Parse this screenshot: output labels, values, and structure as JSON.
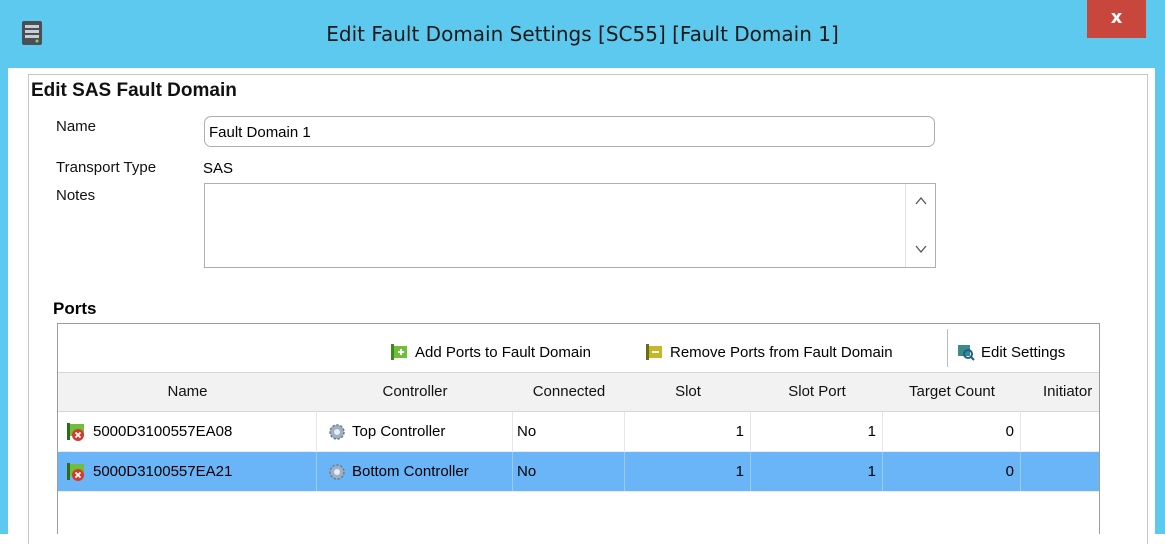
{
  "window": {
    "title": "Edit Fault Domain Settings [SC55] [Fault Domain 1]",
    "close_label": "x",
    "accent_color": "#5ec9ee",
    "close_color": "#c9463d",
    "app_icon": "storage-center-icon"
  },
  "form": {
    "section_title": "Edit SAS Fault Domain",
    "name_label": "Name",
    "name_value": "Fault Domain 1",
    "transport_label": "Transport Type",
    "transport_value": "SAS",
    "notes_label": "Notes",
    "notes_value": ""
  },
  "ports": {
    "title": "Ports",
    "toolbar": {
      "add_label": "Add Ports to Fault Domain",
      "remove_label": "Remove Ports from Fault Domain",
      "edit_label": "Edit Settings"
    },
    "columns": [
      "Name",
      "Controller",
      "Connected",
      "Slot",
      "Slot Port",
      "Target Count",
      "Initiator"
    ],
    "rows": [
      {
        "name": "5000D3100557EA08",
        "controller": "Top Controller",
        "connected": "No",
        "slot": "1",
        "slot_port": "1",
        "target_count": "0",
        "initiator": "",
        "selected": false
      },
      {
        "name": "5000D3100557EA21",
        "controller": "Bottom Controller",
        "connected": "No",
        "slot": "1",
        "slot_port": "1",
        "target_count": "0",
        "initiator": "",
        "selected": true
      }
    ],
    "selection_color": "#6ab4f8"
  }
}
